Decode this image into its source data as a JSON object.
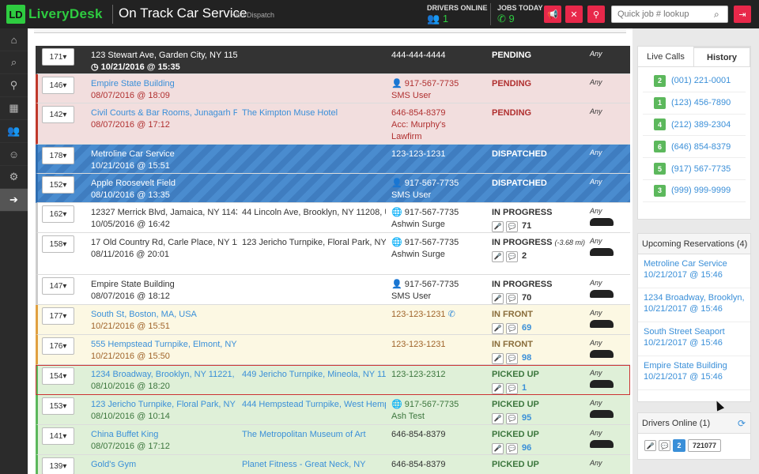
{
  "top": {
    "logo_badge": "LD",
    "logo_text": "LiveryDesk",
    "brand": "On Track Car Service",
    "brand_sub": "Kish Dispatch",
    "drivers_label": "DRIVERS ONLINE",
    "drivers_value": "1",
    "jobs_label": "JOBS TODAY",
    "jobs_value": "9",
    "search_placeholder": "Quick job # lookup"
  },
  "jobs": [
    {
      "job": "171",
      "pickup": "123 Stewart Ave, Garden City, NY 115",
      "date": "10/21/2016 @ 15:35",
      "dropoff": "",
      "phone": "444-444-4444",
      "phone2": "",
      "status": "PENDING",
      "status_sub": "",
      "veh": "Any",
      "count": ""
    },
    {
      "job": "146",
      "pickup": "Empire State Building",
      "date": "08/07/2016 @ 18:09",
      "dropoff": "",
      "phone": "917-567-7735",
      "phone2": "SMS User",
      "status": "PENDING",
      "status_sub": "",
      "veh": "Any",
      "count": ""
    },
    {
      "job": "142",
      "pickup": "Civil Courts & Bar Rooms, Junagarh F",
      "date": "08/07/2016 @ 17:12",
      "dropoff": "The Kimpton Muse Hotel",
      "phone": "646-854-8379",
      "phone2": "Acc: Murphy's Lawfirm",
      "status": "PENDING",
      "status_sub": "",
      "veh": "Any",
      "count": ""
    },
    {
      "job": "178",
      "pickup": "Metroline Car Service",
      "date": "10/21/2016 @ 15:51",
      "dropoff": "",
      "phone": "123-123-1231",
      "phone2": "",
      "status": "DISPATCHED",
      "status_sub": "",
      "veh": "Any",
      "count": ""
    },
    {
      "job": "152",
      "pickup": "Apple Roosevelt Field",
      "date": "08/10/2016 @ 13:35",
      "dropoff": "",
      "phone": "917-567-7735",
      "phone2": "SMS User",
      "status": "DISPATCHED",
      "status_sub": "",
      "veh": "Any",
      "count": ""
    },
    {
      "job": "162",
      "pickup": "12327 Merrick Blvd, Jamaica, NY 1143",
      "date": "10/05/2016 @ 16:42",
      "dropoff": "44 Lincoln Ave, Brooklyn, NY 11208, U",
      "phone": "917-567-7735",
      "phone2": "Ashwin Surge",
      "status": "IN PROGRESS",
      "status_sub": "",
      "veh": "Any",
      "count": "71"
    },
    {
      "job": "158",
      "pickup": "17 Old Country Rd, Carle Place, NY 11",
      "date": "08/11/2016 @ 20:01",
      "dropoff": "123 Jericho Turnpike, Floral Park, NY",
      "phone": "917-567-7735",
      "phone2": "Ashwin Surge",
      "status": "IN PROGRESS",
      "status_sub": "(-3.68 mi)",
      "veh": "Any",
      "count": "2"
    },
    {
      "job": "147",
      "pickup": "Empire State Building",
      "date": "08/07/2016 @ 18:12",
      "dropoff": "",
      "phone": "917-567-7735",
      "phone2": "SMS User",
      "status": "IN PROGRESS",
      "status_sub": "",
      "veh": "Any",
      "count": "70"
    },
    {
      "job": "177",
      "pickup": "South St, Boston, MA, USA",
      "date": "10/21/2016 @ 15:51",
      "dropoff": "",
      "phone": "123-123-1231",
      "phone2": "",
      "status": "IN FRONT",
      "status_sub": "",
      "veh": "Any",
      "count": "69"
    },
    {
      "job": "176",
      "pickup": "555 Hempstead Turnpike, Elmont, NY",
      "date": "10/21/2016 @ 15:50",
      "dropoff": "",
      "phone": "123-123-1231",
      "phone2": "",
      "status": "IN FRONT",
      "status_sub": "",
      "veh": "Any",
      "count": "98"
    },
    {
      "job": "154",
      "pickup": "1234 Broadway, Brooklyn, NY 11221,",
      "date": "08/10/2016 @ 18:20",
      "dropoff": "449 Jericho Turnpike, Mineola, NY 115",
      "phone": "123-123-2312",
      "phone2": "",
      "status": "PICKED UP",
      "status_sub": "",
      "veh": "Any",
      "count": "1"
    },
    {
      "job": "153",
      "pickup": "123 Jericho Turnpike, Floral Park, NY",
      "date": "08/10/2016 @ 10:14",
      "dropoff": "444 Hempstead Turnpike, West Hemp",
      "phone": "917-567-7735",
      "phone2": "Ash Test",
      "status": "PICKED UP",
      "status_sub": "",
      "veh": "Any",
      "count": "95"
    },
    {
      "job": "141",
      "pickup": "China Buffet King",
      "date": "08/07/2016 @ 17:12",
      "dropoff": "The Metropolitan Museum of Art",
      "phone": "646-854-8379",
      "phone2": "",
      "status": "PICKED UP",
      "status_sub": "",
      "veh": "Any",
      "count": "96"
    },
    {
      "job": "139",
      "pickup": "Gold's Gym",
      "date": "",
      "dropoff": "Planet Fitness - Great Neck, NY",
      "phone": "646-854-8379",
      "phone2": "",
      "status": "PICKED UP",
      "status_sub": "",
      "veh": "Any",
      "count": ""
    }
  ],
  "side": {
    "tab_live": "Live Calls",
    "tab_history": "History",
    "history": [
      {
        "n": "2",
        "phone": "(001) 221-0001"
      },
      {
        "n": "1",
        "phone": "(123) 456-7890"
      },
      {
        "n": "4",
        "phone": "(212) 389-2304"
      },
      {
        "n": "6",
        "phone": "(646) 854-8379"
      },
      {
        "n": "5",
        "phone": "(917) 567-7735"
      },
      {
        "n": "3",
        "phone": "(999) 999-9999"
      }
    ],
    "upcoming_title": "Upcoming Reservations (4)",
    "upcoming": [
      {
        "name": "Metroline Car Service",
        "date": "10/21/2017 @ 15:46"
      },
      {
        "name": "1234 Broadway, Brooklyn,",
        "date": "10/21/2017 @ 15:46"
      },
      {
        "name": "South Street Seaport",
        "date": "10/21/2017 @ 15:46"
      },
      {
        "name": "Empire State Building",
        "date": "10/21/2017 @ 15:46"
      }
    ],
    "drivers_title": "Drivers Online (1)",
    "driver_num": "2",
    "driver_id": "721077"
  },
  "colors": {
    "accent_red": "#e8284a",
    "brand_green": "#2ecc40",
    "link_blue": "#3a8fd8"
  }
}
